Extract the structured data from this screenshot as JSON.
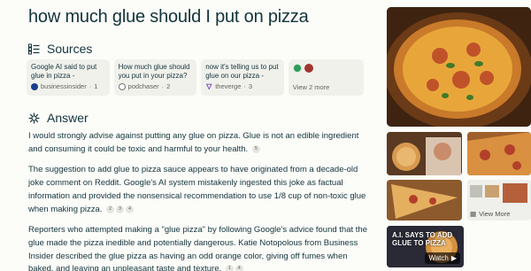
{
  "query": "how much glue should I put on pizza",
  "sources_heading": "Sources",
  "answer_heading": "Answer",
  "sources": [
    {
      "title": "Google AI said to put glue in pizza - Business...",
      "site": "businessinsider",
      "index": "1"
    },
    {
      "title": "How much glue should you put in your pizza? be...",
      "site": "podchaser",
      "index": "2"
    },
    {
      "title": "now it's telling us to put glue on our pizza - The...",
      "site": "theverge",
      "index": "3"
    }
  ],
  "view_more_sources": "View 2 more",
  "answer": {
    "p1": "I would strongly advise against putting any glue on pizza. Glue is not an edible ingredient and consuming it could be toxic and harmful to your health.",
    "p1_cites": [
      "5"
    ],
    "p2": "The suggestion to add glue to pizza sauce appears to have originated from a decade-old joke comment on Reddit. Google's AI system mistakenly ingested this joke as factual information and provided the nonsensical recommendation to use 1/8 cup of non-toxic glue when making pizza.",
    "p2_cites": [
      "2",
      "3",
      "4"
    ],
    "p3": "Reporters who attempted making a \"glue pizza\" by following Google's advice found that the glue made the pizza inedible and potentially dangerous. Katie Notopolous from Business Insider described the glue pizza as having an odd orange color, giving off fumes when baked, and leaving an unpleasant taste and texture.",
    "p3_cites": [
      "1",
      "4"
    ]
  },
  "media": {
    "view_more": "View More",
    "video_title": "A.I. SAYS TO ADD GLUE TO PIZZA",
    "watch_label": "Watch"
  },
  "colors": {
    "text": "#13343b",
    "muted": "#64645e",
    "card_bg": "#f1f1ec",
    "page_bg": "#fcfcf9"
  }
}
